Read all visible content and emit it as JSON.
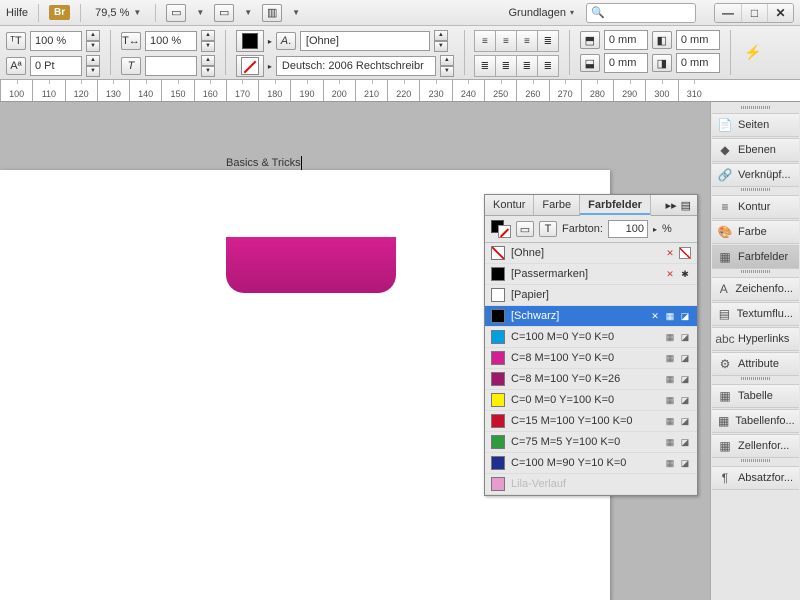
{
  "menubar": {
    "help": "Hilfe",
    "bridge_badge": "Br",
    "zoom": "79,5 %",
    "workspace": "Grundlagen"
  },
  "controlbar": {
    "size_pct_1": "100 %",
    "size_pct_2": "100 %",
    "leading": "0 Pt",
    "fill_style": "[Ohne]",
    "language": "Deutsch: 2006 Rechtschreibr",
    "inset_top": "0 mm",
    "inset_bottom": "0 mm",
    "inset_left": "0 mm",
    "inset_right": "0 mm"
  },
  "ruler": [
    "100",
    "110",
    "120",
    "130",
    "140",
    "150",
    "160",
    "170",
    "180",
    "190",
    "200",
    "210",
    "220",
    "230",
    "240",
    "250",
    "260",
    "270",
    "280",
    "290",
    "300",
    "310"
  ],
  "document": {
    "title_text": "Basics & Tricks"
  },
  "swatches_panel": {
    "tabs": [
      "Kontur",
      "Farbe",
      "Farbfelder"
    ],
    "active_tab": 2,
    "tint_label": "Farbton:",
    "tint_value": "100",
    "tint_unit": "%",
    "items": [
      {
        "name": "[Ohne]",
        "chip": "none",
        "locked": true,
        "none": true
      },
      {
        "name": "[Passermarken]",
        "chip": "#000000",
        "locked": true,
        "reg": true
      },
      {
        "name": "[Papier]",
        "chip": "#ffffff"
      },
      {
        "name": "[Schwarz]",
        "chip": "#000000",
        "locked": true,
        "selected": true,
        "cmyk": true
      },
      {
        "name": "C=100 M=0 Y=0 K=0",
        "chip": "#00a0e3",
        "cmyk": true
      },
      {
        "name": "C=8 M=100 Y=0 K=0",
        "chip": "#d4208f",
        "cmyk": true
      },
      {
        "name": "C=8 M=100 Y=0 K=26",
        "chip": "#9e1869",
        "cmyk": true
      },
      {
        "name": "C=0 M=0 Y=100 K=0",
        "chip": "#fff200",
        "cmyk": true
      },
      {
        "name": "C=15 M=100 Y=100 K=0",
        "chip": "#c8102e",
        "cmyk": true
      },
      {
        "name": "C=75 M=5 Y=100 K=0",
        "chip": "#2e9b3c",
        "cmyk": true
      },
      {
        "name": "C=100 M=90 Y=10 K=0",
        "chip": "#1d2f8f",
        "cmyk": true
      },
      {
        "name": "Lila-Verlauf",
        "chip": "#e69ccf",
        "muted": true
      }
    ]
  },
  "right_panels": {
    "groups": [
      [
        "Seiten",
        "Ebenen",
        "Verknüpf..."
      ],
      [
        "Kontur",
        "Farbe",
        "Farbfelder"
      ],
      [
        "Zeichenfo...",
        "Textumflu...",
        "Hyperlinks",
        "Attribute"
      ],
      [
        "Tabelle",
        "Tabellenfo...",
        "Zellenfor..."
      ],
      [
        "Absatzfor..."
      ]
    ],
    "selected": "Farbfelder",
    "icons": {
      "Seiten": "📄",
      "Ebenen": "◆",
      "Verknüpf...": "🔗",
      "Kontur": "≡",
      "Farbe": "🎨",
      "Farbfelder": "▦",
      "Zeichenfo...": "A",
      "Textumflu...": "▤",
      "Hyperlinks": "abc",
      "Attribute": "⚙",
      "Tabelle": "▦",
      "Tabellenfo...": "▦",
      "Zellenfor...": "▦",
      "Absatzfor...": "¶"
    }
  }
}
